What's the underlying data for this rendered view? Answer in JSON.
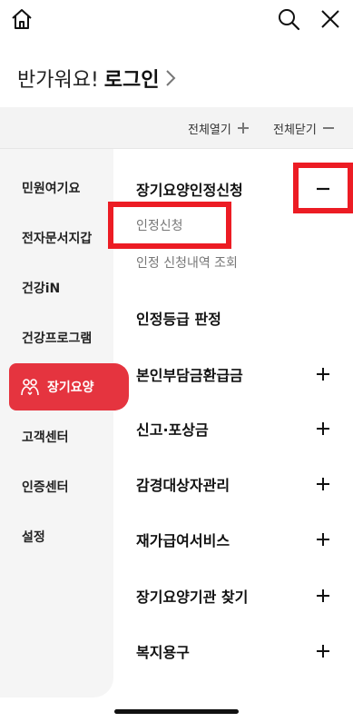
{
  "colors": {
    "accent": "#e5343f",
    "highlight": "#ec1c24",
    "sidebar_bg": "#f5f5f5"
  },
  "topbar": {
    "home_icon": "home-icon",
    "search_icon": "search-icon",
    "close_icon": "close-icon"
  },
  "greeting": {
    "hello": "반가워요!",
    "login": "로그인"
  },
  "controls": {
    "expand_all": "전체열기",
    "collapse_all": "전체닫기"
  },
  "sidebar": {
    "items": [
      {
        "label": "민원여기요",
        "active": false
      },
      {
        "label": "전자문서지갑",
        "active": false
      },
      {
        "label": "건강iN",
        "active": false
      },
      {
        "label": "건강프로그램",
        "active": false
      },
      {
        "label": "장기요양",
        "active": true,
        "icon": "people-icon"
      },
      {
        "label": "고객센터",
        "active": false
      },
      {
        "label": "인증센터",
        "active": false
      },
      {
        "label": "설정",
        "active": false
      }
    ]
  },
  "menu": {
    "categories": [
      {
        "label": "장기요양인정신청",
        "state": "expanded",
        "toggle": "minus"
      },
      {
        "label": "인정등급 판정",
        "state": "none",
        "toggle": ""
      },
      {
        "label": "본인부담금환급금",
        "state": "collapsed",
        "toggle": "plus"
      },
      {
        "label": "신고·포상금",
        "state": "collapsed",
        "toggle": "plus"
      },
      {
        "label": "감경대상자관리",
        "state": "collapsed",
        "toggle": "plus"
      },
      {
        "label": "재가급여서비스",
        "state": "collapsed",
        "toggle": "plus"
      },
      {
        "label": "장기요양기관 찾기",
        "state": "collapsed",
        "toggle": "plus"
      },
      {
        "label": "복지용구",
        "state": "collapsed",
        "toggle": "plus"
      }
    ],
    "subitems": [
      {
        "label": "인정신청"
      },
      {
        "label": "인정 신청내역 조회"
      }
    ]
  }
}
